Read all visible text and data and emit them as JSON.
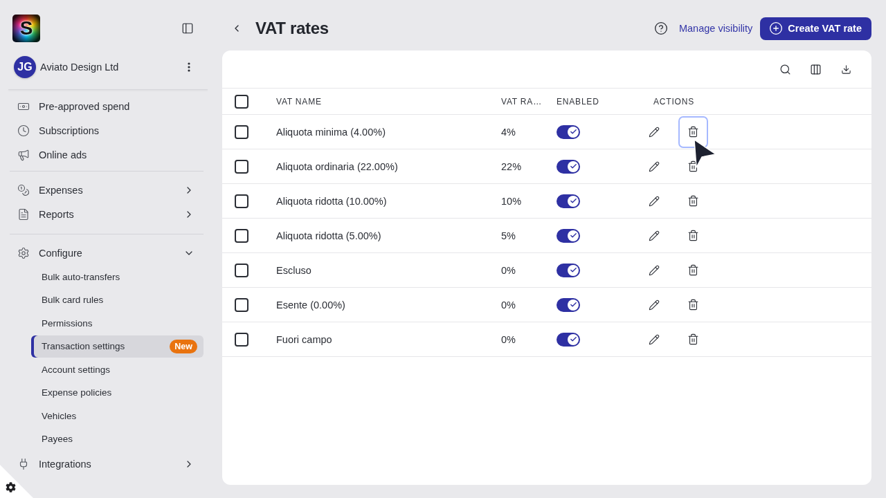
{
  "sidebar": {
    "logo_letter": "S",
    "organization": {
      "initials": "JG",
      "name": "Aviato Design Ltd"
    },
    "sections": [
      {
        "items": [
          {
            "label": "Pre-approved spend",
            "selected": false
          },
          {
            "label": "Subscriptions",
            "selected": false
          },
          {
            "label": "Online ads",
            "selected": false
          }
        ]
      },
      {
        "items": [
          {
            "label": "Expenses",
            "selected": false,
            "expanded": false
          },
          {
            "label": "Reports",
            "selected": false,
            "expanded": false
          }
        ]
      },
      {
        "items": [
          {
            "label": "Configure",
            "selected": false,
            "expanded": true,
            "children": [
              {
                "label": "Bulk auto-transfers",
                "selected": false
              },
              {
                "label": "Bulk card rules",
                "selected": false
              },
              {
                "label": "Permissions",
                "selected": false
              },
              {
                "label": "Transaction settings",
                "selected": true,
                "badge": "New"
              },
              {
                "label": "Account settings",
                "selected": false
              },
              {
                "label": "Expense policies",
                "selected": false
              },
              {
                "label": "Vehicles",
                "selected": false
              },
              {
                "label": "Payees",
                "selected": false
              }
            ]
          },
          {
            "label": "Integrations",
            "selected": false,
            "expanded": false
          }
        ]
      }
    ]
  },
  "header": {
    "title": "VAT rates",
    "visibility_link": "Manage visibility",
    "create_button": "Create VAT rate"
  },
  "table": {
    "header_checked": false,
    "columns": [
      "VAT NAME",
      "VAT RA…",
      "ENABLED",
      "ACTIONS"
    ],
    "rows": [
      {
        "checked": false,
        "name": "Aliquota minima (4.00%)",
        "rate": "4%",
        "enabled": true,
        "delete_focused": true
      },
      {
        "checked": false,
        "name": "Aliquota ordinaria (22.00%)",
        "rate": "22%",
        "enabled": true,
        "delete_focused": false
      },
      {
        "checked": false,
        "name": "Aliquota ridotta (10.00%)",
        "rate": "10%",
        "enabled": true,
        "delete_focused": false
      },
      {
        "checked": false,
        "name": "Aliquota ridotta (5.00%)",
        "rate": "5%",
        "enabled": true,
        "delete_focused": false
      },
      {
        "checked": false,
        "name": "Escluso",
        "rate": "0%",
        "enabled": true,
        "delete_focused": false
      },
      {
        "checked": false,
        "name": "Esente (0.00%)",
        "rate": "0%",
        "enabled": true,
        "delete_focused": false
      },
      {
        "checked": false,
        "name": "Fuori campo",
        "rate": "0%",
        "enabled": true,
        "delete_focused": false
      }
    ]
  }
}
